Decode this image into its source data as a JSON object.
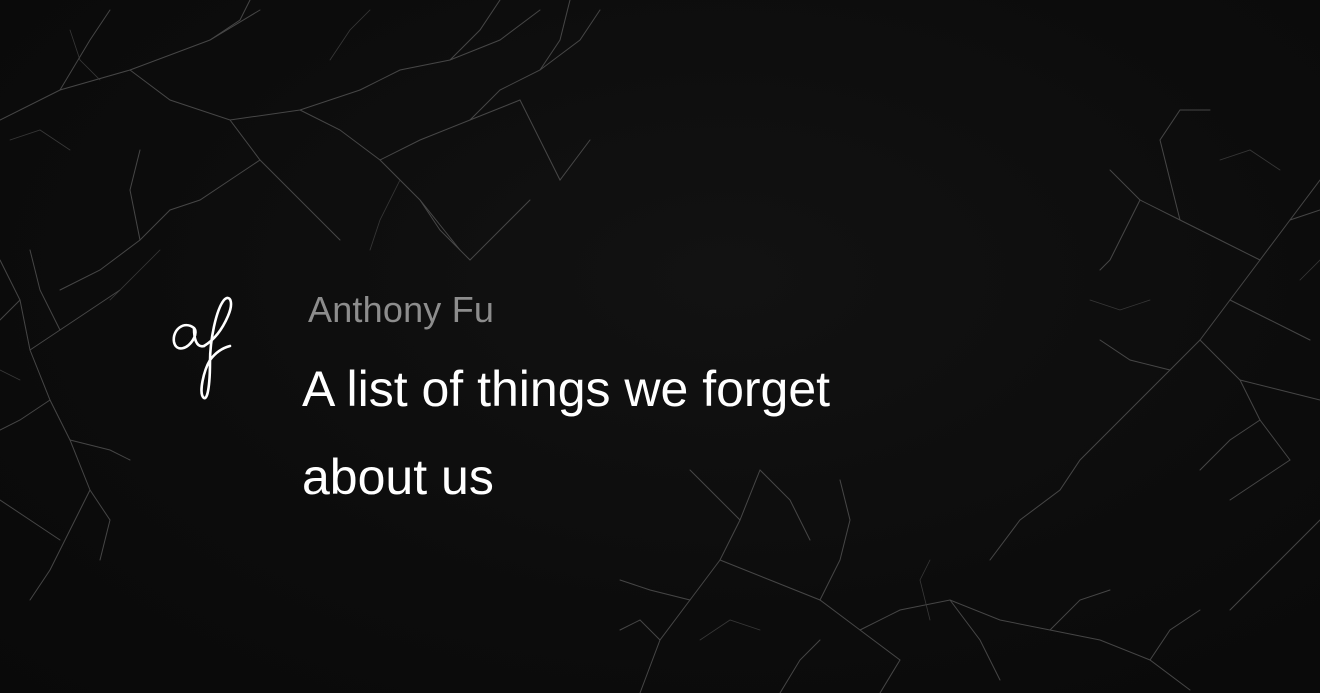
{
  "author": {
    "name": "Anthony Fu",
    "logo_icon": "af-signature-logo"
  },
  "post": {
    "title": "A list of things we forget about us"
  },
  "theme": {
    "background": "#0d0d0d",
    "text_primary": "#ffffff",
    "text_secondary": "#8d8d8d",
    "branch_color": "#6a6a6a"
  }
}
